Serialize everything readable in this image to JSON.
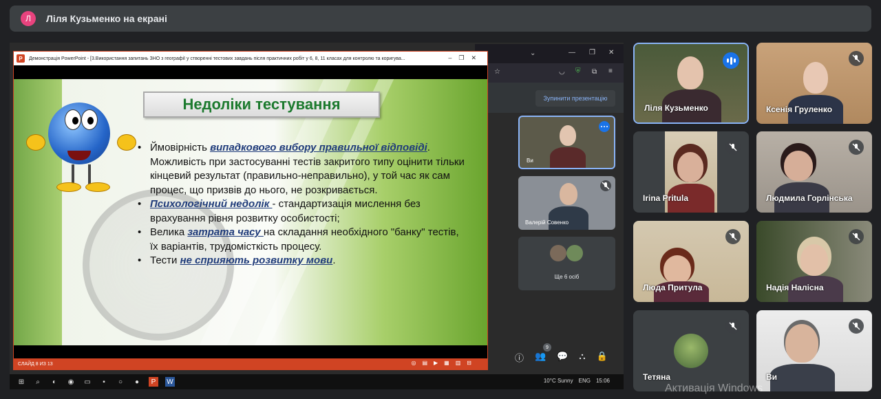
{
  "presenter_bar": {
    "avatar_letter": "Л",
    "text": "Ліля Кузьменко на екрані"
  },
  "shared_screen": {
    "ppt_window_title": "Демонстрація PowerPoint - [3.Використання запитань ЗНО з географії у створенні тестових завдань після практичних робіт у 6, 8, 11 класах для контролю та коригува...",
    "stop_presentation_label": "Зупинити презентацію",
    "slide": {
      "heading": "Недоліки тестування",
      "bullets": [
        {
          "pre": "Ймовірність ",
          "em": "випадкового вибору правильної відповіді",
          "post": ". Можливість при застосуванні тестів закритого типу оцінити тільки кінцевий результат (правильно-неправильно), у той час як сам процес, що призвів до нього, не розкривається."
        },
        {
          "pre": "",
          "em": "Психологічний недолік ",
          "post": " - стандартизація мислення без врахування рівня розвитку особистості;"
        },
        {
          "pre": "Велика ",
          "em": "затрата часу ",
          "post": "на складання необхідного \"банку\" тестів, їх варіантів, трудомісткість процесу."
        },
        {
          "pre": "Тести ",
          "em": "не сприяють розвитку мови",
          "post": "."
        }
      ]
    },
    "ppt_status": "СЛАЙД 8 ИЗ 13",
    "inner_tiles": {
      "self_label": "Ви",
      "valeriy_label": "Валерій Совенко",
      "more_label": "Ще 6 осіб"
    },
    "participants_badge": "9",
    "taskbar": {
      "weather": "10°C  Sunny",
      "lang": "ENG",
      "time": "15:06"
    }
  },
  "participants": [
    {
      "name": "Ліля Кузьменко",
      "state": "speaking"
    },
    {
      "name": "Ксенія Груленко",
      "state": "muted"
    },
    {
      "name": "Irina Pritula",
      "state": "muted"
    },
    {
      "name": "Людмила Горлінська",
      "state": "muted"
    },
    {
      "name": "Люда Притула",
      "state": "muted"
    },
    {
      "name": "Надія Налісна",
      "state": "muted"
    },
    {
      "name": "Тетяна",
      "state": "muted"
    },
    {
      "name": "Ви",
      "state": "muted"
    }
  ],
  "watermark": "Активація Windows",
  "colors": {
    "speaking_border": "#8ab4f8",
    "ppt_accent": "#d04423",
    "slide_heading": "#1c7a2e",
    "emphasis_text": "#1f3b7a"
  }
}
